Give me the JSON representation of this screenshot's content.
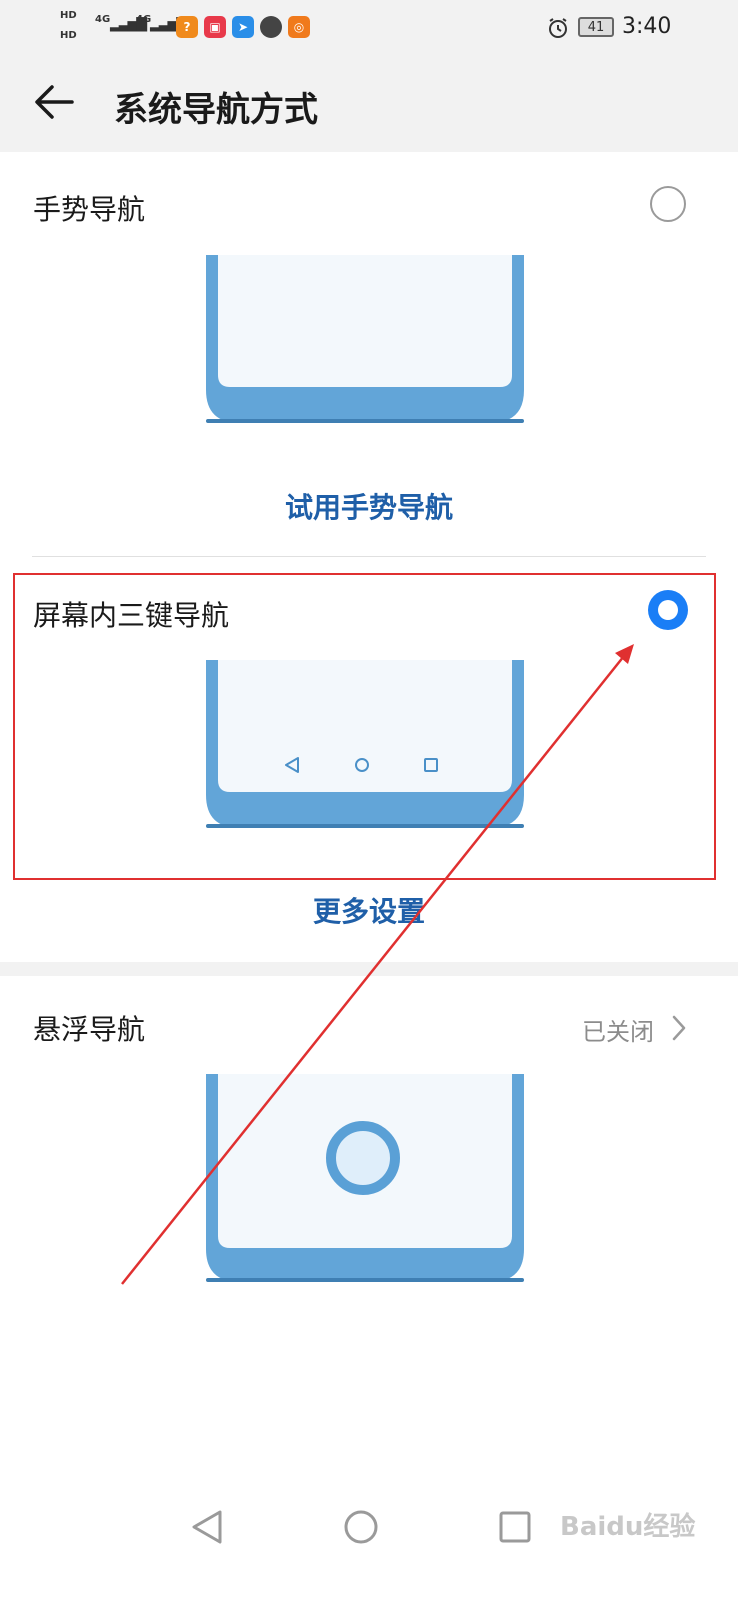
{
  "status_bar": {
    "hd1": "HD",
    "hd2": "HD",
    "net1": "4G",
    "net2": "4G",
    "battery": "41",
    "time": "3:40"
  },
  "header": {
    "title": "系统导航方式"
  },
  "gesture": {
    "label": "手势导航",
    "selected": false,
    "try_label": "试用手势导航"
  },
  "three_key": {
    "label": "屏幕内三键导航",
    "selected": true,
    "more_label": "更多设置"
  },
  "float_nav": {
    "label": "悬浮导航",
    "value": "已关闭"
  },
  "watermark": "Baidu经验",
  "colors": {
    "accent": "#1a7ef6",
    "link": "#1f5fa8",
    "phone_frame": "#62a5d8",
    "phone_screen": "#f3f8fc",
    "annotation_red": "#e03030"
  }
}
